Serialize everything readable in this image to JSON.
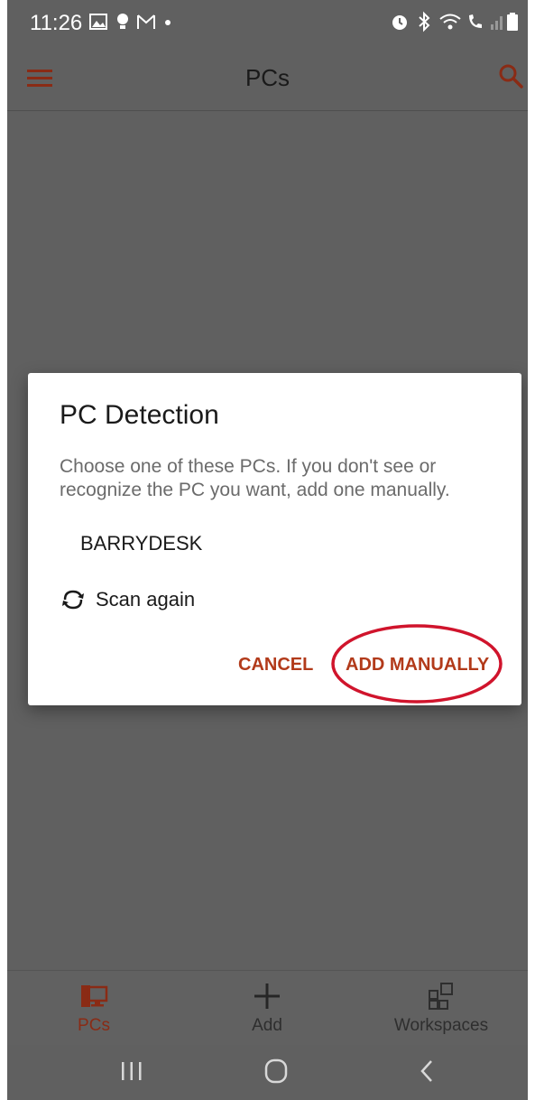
{
  "status_bar": {
    "time": "11:26"
  },
  "app_bar": {
    "title": "PCs",
    "menu_icon": "hamburger-menu-icon",
    "search_icon": "search-icon"
  },
  "dialog": {
    "title": "PC Detection",
    "message": "Choose one of these PCs. If you don't see or recognize the PC you want, add one manually.",
    "pcs": [
      "BARRYDESK"
    ],
    "scan_again_label": "Scan again",
    "cancel_label": "CANCEL",
    "add_manually_label": "ADD MANUALLY"
  },
  "bottom_nav": {
    "items": [
      {
        "label": "PCs",
        "icon": "pc-monitor-icon",
        "active": true
      },
      {
        "label": "Add",
        "icon": "plus-icon",
        "active": false
      },
      {
        "label": "Workspaces",
        "icon": "workspaces-grid-icon",
        "active": false
      }
    ]
  },
  "colors": {
    "accent": "#b23a1a",
    "scrim": "#606060",
    "highlight": "#d0142c"
  }
}
